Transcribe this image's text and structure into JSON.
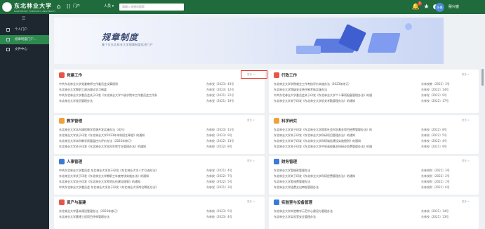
{
  "topbar": {
    "logo_text": "东北林业大学",
    "logo_sub": "NORTHEAST FORESTRY UNIVERSITY",
    "tab": "门户",
    "chip_label": "人员",
    "search_placeholder": "请输入关键词搜索",
    "notification_count": "1",
    "user_avatar_text": "头像",
    "user_name": "殷兴盛"
  },
  "sidebar": {
    "collapse_symbol": "☰",
    "items": [
      {
        "label": "个人门户"
      },
      {
        "label": "规章制度门户..."
      },
      {
        "label": "文件中心"
      }
    ]
  },
  "banner": {
    "title": "规章制度",
    "subtitle": "集个位东北林业大学规章制度信息门户"
  },
  "panels": [
    {
      "title": "党建工作",
      "color": "#e8564a",
      "more": "更多 >",
      "rows": [
        {
          "doc": "中共东北林业大学党委教师工作委员会议事规则",
          "num": "东林党〔2023〕43号"
        },
        {
          "doc": "东北林业大学教职工政治理论学习制度",
          "num": "东林党〔2023〕12号"
        },
        {
          "doc": "中共东北林业大学委员会关于印发《东北林业大学二级学院本工作委员会工作条例（试行）》的通知",
          "num": "东林党〔2021〕22号"
        },
        {
          "doc": "东北林业大学党员管理办法",
          "num": "东林党〔2021〕19号"
        }
      ]
    },
    {
      "title": "行政工作",
      "color": "#e8564a",
      "more": "更多 >",
      "rows": [
        {
          "doc": "东北林业大学学院就业工作考核评价实施办法（2023年修订）",
          "num": "东林校教〔2023〕3号"
        },
        {
          "doc": "东北林业大学院级安全责任制考核实施办法",
          "num": "东林校〔2022〕14号"
        },
        {
          "doc": "中共东北林业大学委员会关于印发《东北林业大学个人事项报备管理办法》的通知",
          "num": "东林党〔2022〕9号"
        },
        {
          "doc": "东北林业大学关于印发《东北林业大学机关考勤管理办法》的通知",
          "num": "东林校〔2022〕17号"
        }
      ]
    },
    {
      "title": "教学管理",
      "color": "#f0a13a",
      "more": "更多 >",
      "rows": [
        {
          "doc": "东北林业大学本科课程教学资源开发实施办法（试行）",
          "num": "东林校〔2023〕11号"
        },
        {
          "doc": "东北林业大学关于印发《东北林业大学2023年本科招生章程》的通知",
          "num": "东林校〔2023〕9号"
        },
        {
          "doc": "东北林业大学本科教学质量监控与评价办法（2022年修订）",
          "num": "东林校〔2022〕13号"
        },
        {
          "doc": "东北林业大学关于印发《东北林业大学本科生转专业管理办法》的通知",
          "num": "东林校〔2022〕8号"
        }
      ]
    },
    {
      "title": "科学研究",
      "color": "#f0a13a",
      "more": "更多 >",
      "rows": [
        {
          "doc": "东北林业大学关于印发《东北林业大学国家社会科学基金项目经费管理办法》的通知",
          "num": "东林校〔2022〕8号"
        },
        {
          "doc": "东北林业大学关于印发《东北林业大学科研项目管理办法》的通知",
          "num": "东林校〔2022〕5号"
        },
        {
          "doc": "东北林业大学关于印发《东北林业大学科研诚信建设实施细则》的通知",
          "num": "东林校〔2022〕4号"
        },
        {
          "doc": "东北林业大学关于印发《东北林业大学中央高校基本科研业务费管理办法》的通知",
          "num": "东林校〔2021〕9号"
        }
      ]
    },
    {
      "title": "人事管理",
      "color": "#3a7bd5",
      "more": "更多 >",
      "rows": [
        {
          "doc": "中共东北林业大学委员会 东北林业大学关于印发《东北林业大学人才引进办法》的通知",
          "num": "东林党〔2021〕4号"
        },
        {
          "doc": "东北林业大学关于印发《东北林业大学教职工年度考核实施办法》的通知",
          "num": "东林校〔2022〕7号"
        },
        {
          "doc": "东北林业大学关于印发《东北林业大学师资队伍建设规划》的通知",
          "num": "东林校〔2022〕5号"
        },
        {
          "doc": "中共东北林业大学委员会 东北林业大学关于印发《东北林业大学岗位聘任办法》的通知",
          "num": "东林党〔2021〕3号"
        }
      ]
    },
    {
      "title": "财务管理",
      "color": "#3a7bd5",
      "more": "更多 >",
      "rows": [
        {
          "doc": "东北林业大学暂借款管理办法",
          "num": "东林校财〔2022〕3号"
        },
        {
          "doc": "东北林业大学关于印发《东北林业大学科研经费管理办法》的通知",
          "num": "东林校财〔2022〕2号"
        },
        {
          "doc": "东北林业大学差旅费管理办法",
          "num": "东林校财〔2022〕1号"
        },
        {
          "doc": "东北林业大学经费支出审批管理办法",
          "num": "东林校财〔2021〕6号"
        }
      ]
    },
    {
      "title": "资产与基建",
      "color": "#e8564a",
      "more": "更多 >",
      "rows": [
        {
          "doc": "东北林业大学基本建设管理办法（2023年修订）",
          "num": "东林校〔2023〕5号"
        },
        {
          "doc": "东北林业大学基建工程项目评审管理办法",
          "num": "东林校〔2023〕4号"
        }
      ]
    },
    {
      "title": "实验室与设备管理",
      "color": "#3a7bd5",
      "more": "更多 >",
      "rows": [
        {
          "doc": "东北林业大学实验教学示范中心建设与管理办法",
          "num": "东林校〔2021〕14号"
        },
        {
          "doc": "东北林业大学实验室安全管理办法",
          "num": "东林校〔2021〕13号"
        }
      ]
    }
  ]
}
